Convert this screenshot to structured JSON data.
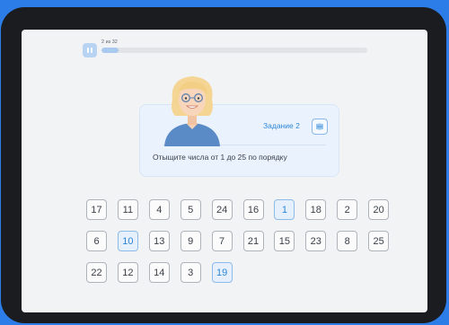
{
  "progress": {
    "label": "2 из 32",
    "fraction": 0.0625
  },
  "icons": {
    "pause": "pause-icon",
    "sound": "sound-icon"
  },
  "colors": {
    "accent": "#2f86d6",
    "frame": "#2d7de8",
    "found_tile": "#e5f0fc"
  },
  "task": {
    "title": "Задание 2",
    "instruction": "Отыщите числа от 1 до 25 по порядку"
  },
  "tiles": [
    {
      "n": "17",
      "found": false
    },
    {
      "n": "11",
      "found": false
    },
    {
      "n": "4",
      "found": false
    },
    {
      "n": "5",
      "found": false
    },
    {
      "n": "24",
      "found": false
    },
    {
      "n": "16",
      "found": false
    },
    {
      "n": "1",
      "found": true
    },
    {
      "n": "18",
      "found": false
    },
    {
      "n": "2",
      "found": false
    },
    {
      "n": "20",
      "found": false
    },
    {
      "n": "6",
      "found": false
    },
    {
      "n": "10",
      "found": true
    },
    {
      "n": "13",
      "found": false
    },
    {
      "n": "9",
      "found": false
    },
    {
      "n": "7",
      "found": false
    },
    {
      "n": "21",
      "found": false
    },
    {
      "n": "15",
      "found": false
    },
    {
      "n": "23",
      "found": false
    },
    {
      "n": "8",
      "found": false
    },
    {
      "n": "25",
      "found": false
    },
    {
      "n": "22",
      "found": false
    },
    {
      "n": "12",
      "found": false
    },
    {
      "n": "14",
      "found": false
    },
    {
      "n": "3",
      "found": false
    },
    {
      "n": "19",
      "found": true
    }
  ]
}
